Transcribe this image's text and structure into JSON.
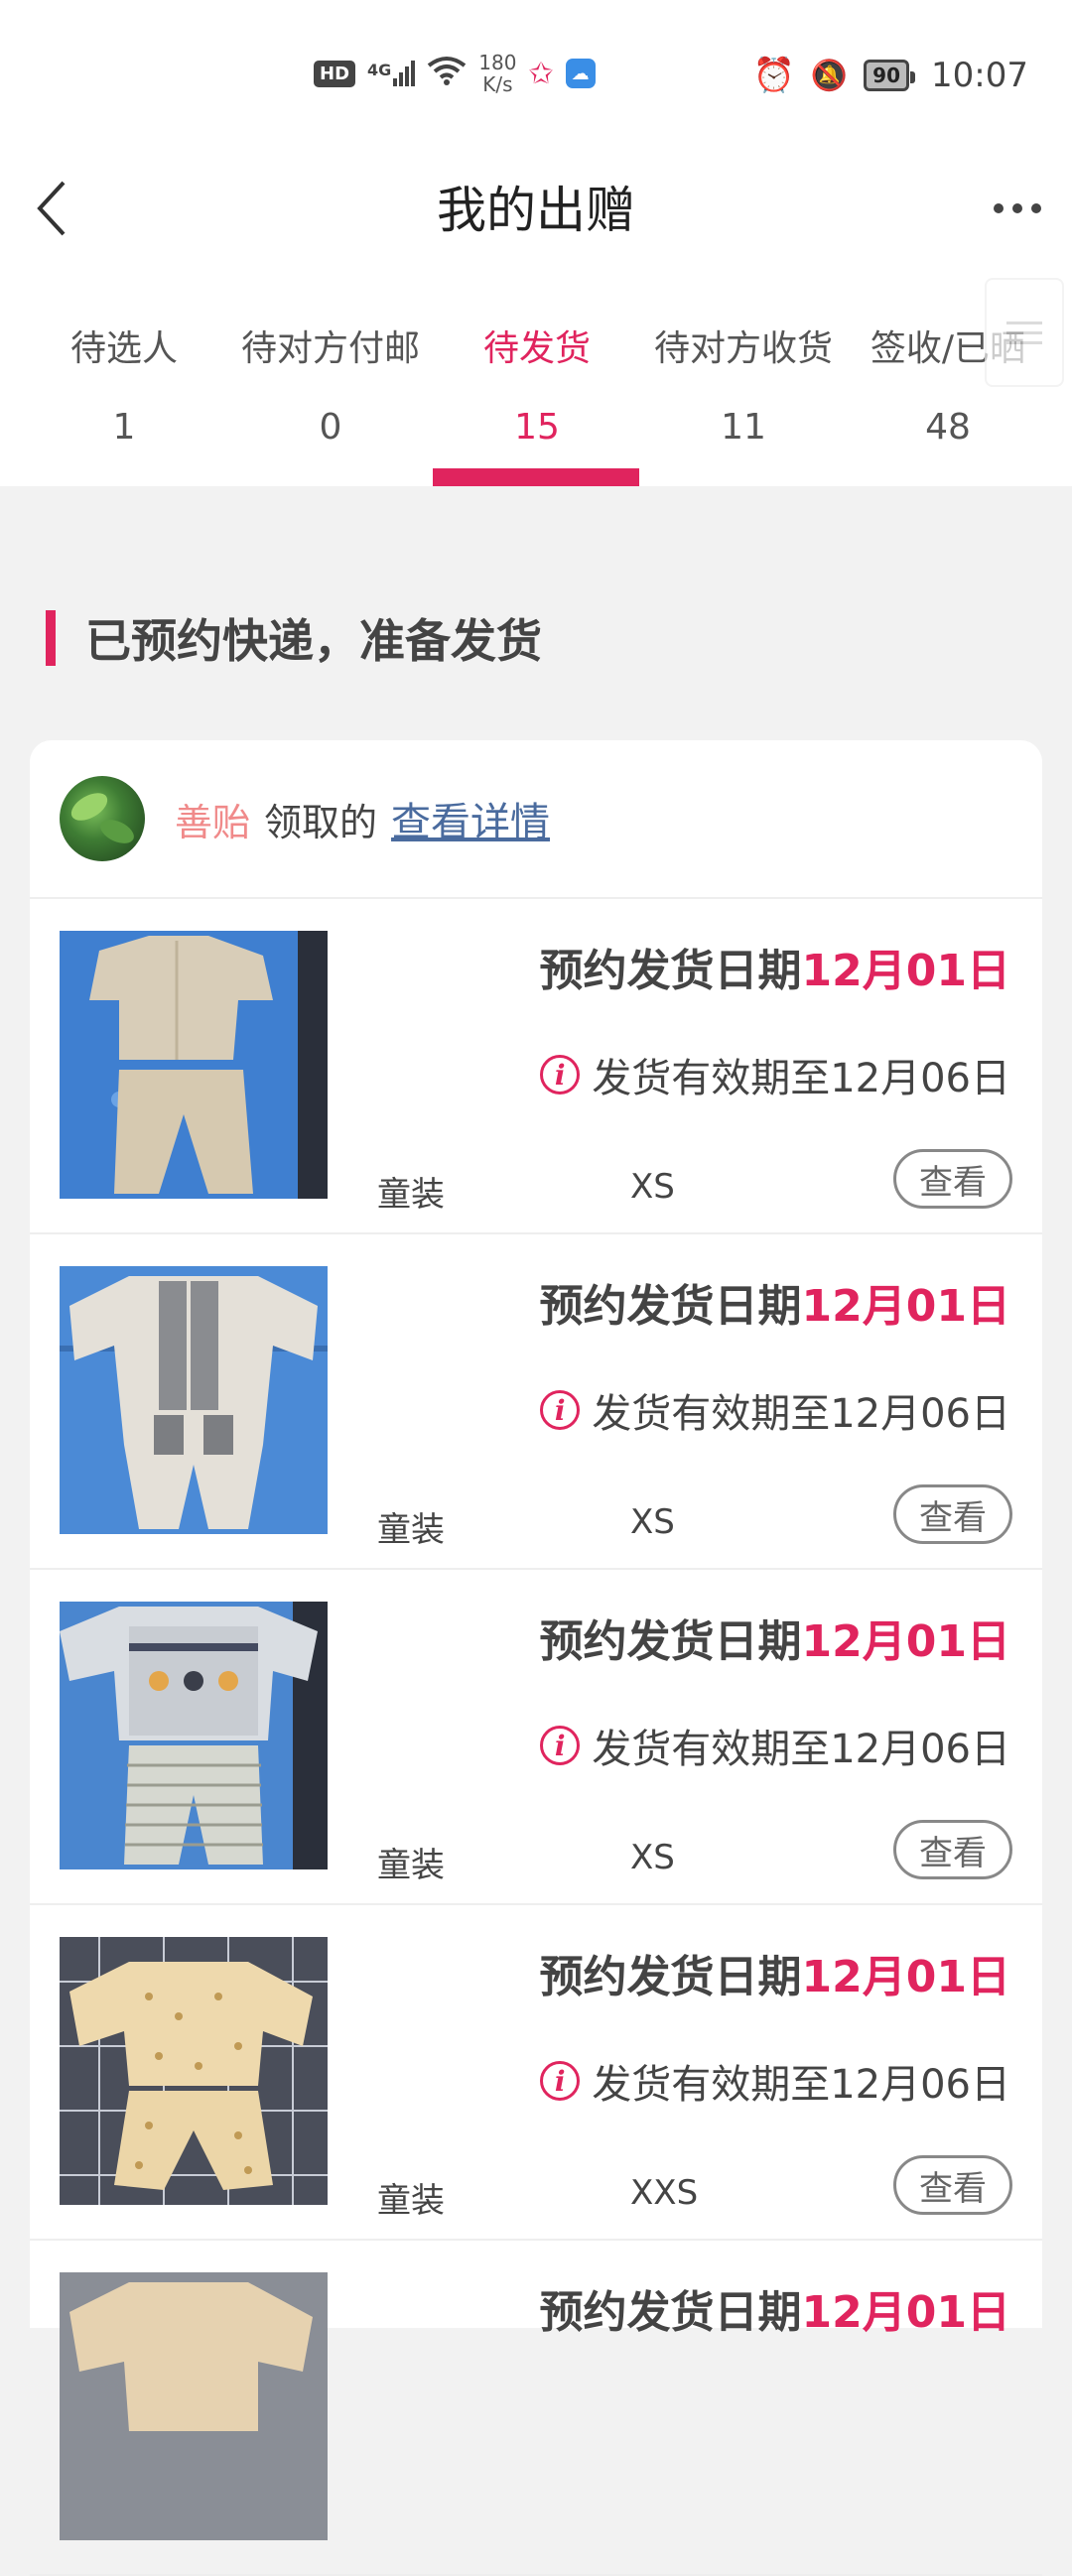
{
  "status_bar": {
    "hd": "HD",
    "network": "4G",
    "speed_value": "180",
    "speed_unit": "K/s",
    "battery": "90",
    "time": "10:07"
  },
  "header": {
    "title": "我的出赠"
  },
  "tabs": [
    {
      "label": "待选人",
      "count": "1"
    },
    {
      "label": "待对方付邮",
      "count": "0"
    },
    {
      "label": "待发货",
      "count": "15"
    },
    {
      "label": "待对方收货",
      "count": "11"
    },
    {
      "label": "签收/已晒",
      "count": "48"
    }
  ],
  "section": {
    "title": "已预约快递，准备发货"
  },
  "donation": {
    "donor_name": "善贻",
    "donor_verb": "领取的",
    "detail_link": "查看详情"
  },
  "items": [
    {
      "date_label": "预约发货日期",
      "date": "12月01日",
      "valid": "发货有效期至12月06日",
      "category": "童装",
      "size": "XS",
      "button": "查看"
    },
    {
      "date_label": "预约发货日期",
      "date": "12月01日",
      "valid": "发货有效期至12月06日",
      "category": "童装",
      "size": "XS",
      "button": "查看"
    },
    {
      "date_label": "预约发货日期",
      "date": "12月01日",
      "valid": "发货有效期至12月06日",
      "category": "童装",
      "size": "XS",
      "button": "查看"
    },
    {
      "date_label": "预约发货日期",
      "date": "12月01日",
      "valid": "发货有效期至12月06日",
      "category": "童装",
      "size": "XXS",
      "button": "查看"
    },
    {
      "date_label": "预约发货日期",
      "date": "12月01日",
      "valid": "",
      "category": "",
      "size": "",
      "button": ""
    }
  ],
  "colors": {
    "accent": "#e0245e",
    "link": "#4a6b9e",
    "donor": "#f08a8a"
  }
}
